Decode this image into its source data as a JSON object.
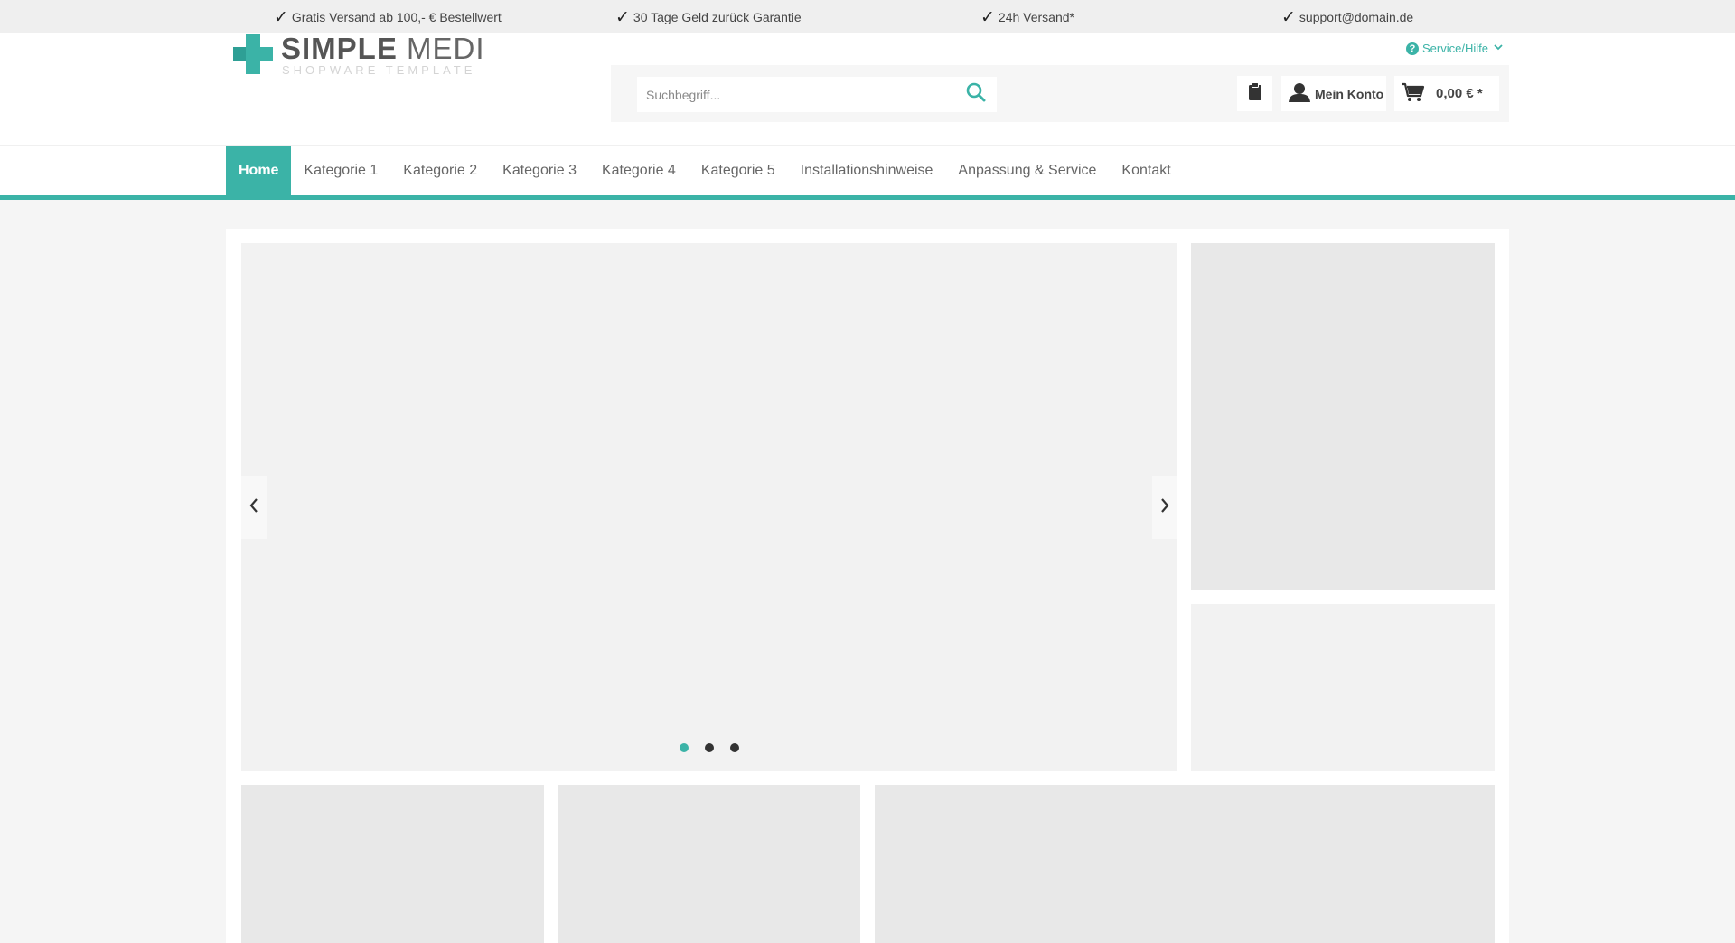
{
  "topbar": {
    "usps": [
      "Gratis Versand ab 100,- € Bestellwert",
      "30 Tage Geld zurück Garantie",
      "24h Versand*",
      "support@domain.de"
    ]
  },
  "logo": {
    "name_bold": "SIMPLE",
    "name_light": " MEDI",
    "tagline": "SHOPWARE TEMPLATE"
  },
  "header": {
    "service_label": "Service/Hilfe",
    "search_placeholder": "Suchbegriff...",
    "account_label": "Mein Konto",
    "cart_total": "0,00 € *"
  },
  "nav": {
    "items": [
      {
        "label": "Home",
        "active": true
      },
      {
        "label": "Kategorie 1"
      },
      {
        "label": "Kategorie 2"
      },
      {
        "label": "Kategorie 3"
      },
      {
        "label": "Kategorie 4"
      },
      {
        "label": "Kategorie 5"
      },
      {
        "label": "Installationshinweise"
      },
      {
        "label": "Anpassung & Service"
      },
      {
        "label": "Kontakt"
      }
    ]
  },
  "slider": {
    "slide_count": 3,
    "active_slide": 1
  },
  "colors": {
    "accent": "#3bb3a7",
    "topbar_bg": "#efefef",
    "placeholder_box": "#f2f2f2"
  },
  "icons": [
    "check-icon",
    "question-icon",
    "chevron-down-icon",
    "search-icon",
    "notepad-icon",
    "user-icon",
    "cart-icon",
    "chevron-left-icon",
    "chevron-right-icon"
  ]
}
